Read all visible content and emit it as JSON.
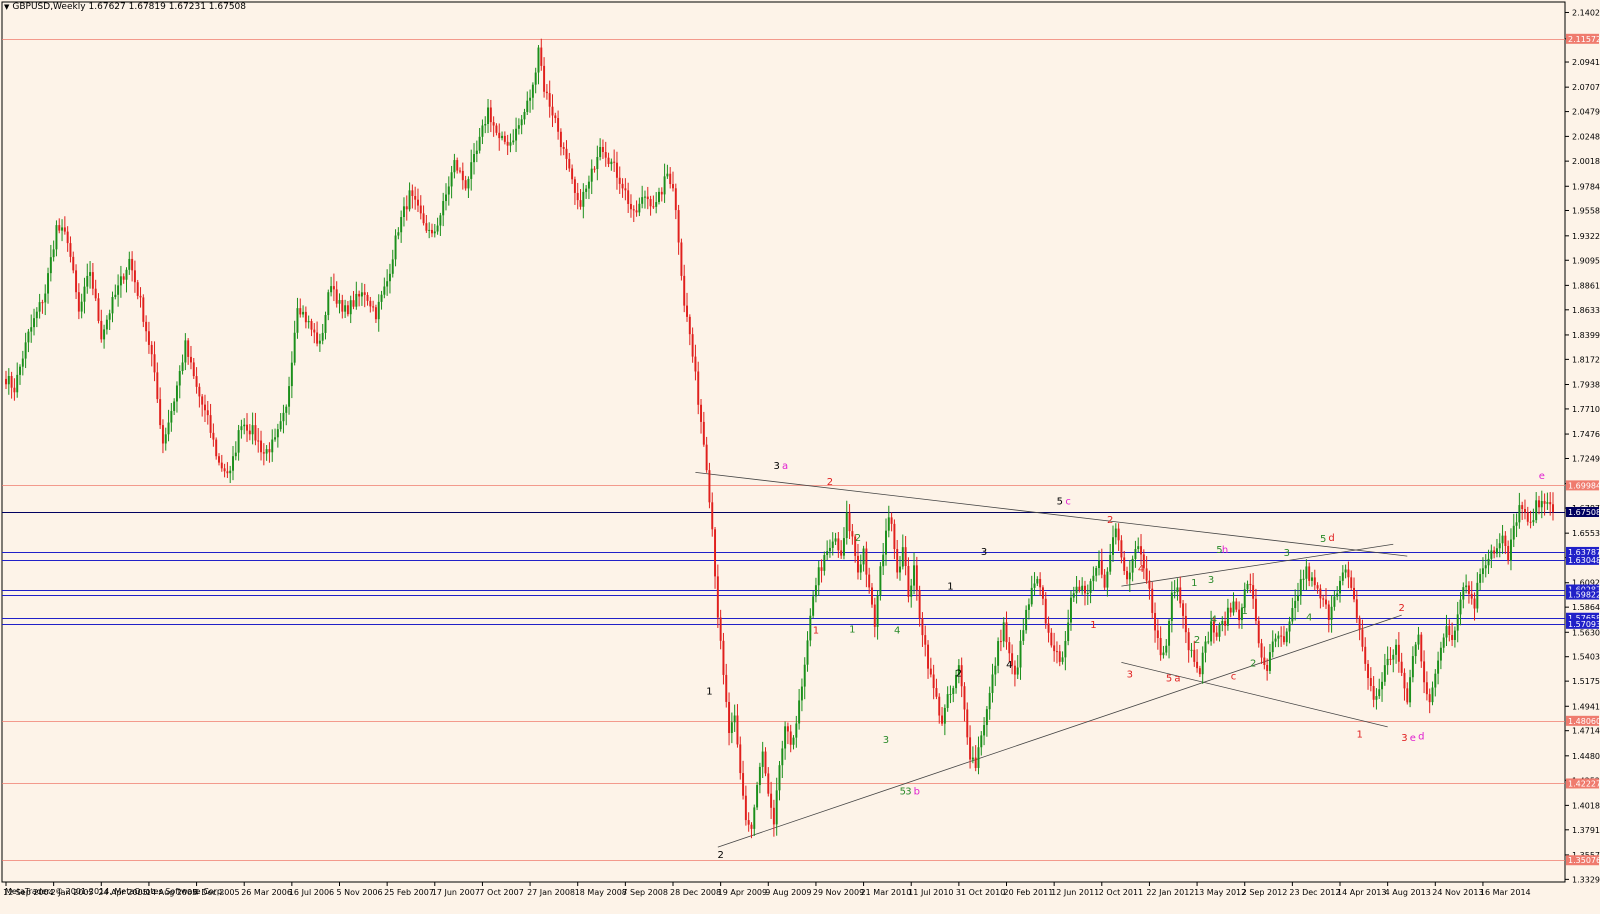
{
  "header": {
    "symbol": "GBPUSD,Weekly",
    "ohlc": "1.67627 1.67819 1.67231 1.67508"
  },
  "footer": {
    "copyright": "MetaTrader, © 2001-2014, MetaQuotes Software Corp."
  },
  "colors": {
    "background": "#fdf3e8",
    "bull": "#1b8f1b",
    "bear": "#e0201d",
    "red_level": "#ef7b6e",
    "blue_level": "#2020c8",
    "current_price": "#000060",
    "wave_magenta": "#e020d0",
    "wave_red": "#e02020",
    "wave_green": "#2a8a2a",
    "wave_black": "#000000"
  },
  "price_axis": {
    "min": 1.3305,
    "max": 2.15,
    "ticks": [
      "2.14025",
      "2.11572",
      "2.09410",
      "2.07070",
      "2.04795",
      "2.02485",
      "2.00180",
      "1.97840",
      "1.95585",
      "1.93225",
      "1.90950",
      "1.88610",
      "1.86335",
      "1.83995",
      "1.81720",
      "1.79380",
      "1.77105",
      "1.74765",
      "1.72490",
      "1.70150",
      "1.67875",
      "1.65535",
      "1.63260",
      "1.60920",
      "1.58645",
      "1.56305",
      "1.54030",
      "1.51755",
      "1.49415",
      "1.47140",
      "1.44800",
      "1.42525",
      "1.40185",
      "1.37910",
      "1.35570",
      "1.33295"
    ]
  },
  "time_axis": {
    "labels": [
      "12 Sep 2004",
      "2 Jan 2005",
      "24 Apr 2005",
      "14 Aug 2005",
      "4 Dec 2005",
      "26 Mar 2006",
      "16 Jul 2006",
      "5 Nov 2006",
      "25 Feb 2007",
      "17 Jun 2007",
      "7 Oct 2007",
      "27 Jan 2008",
      "18 May 2008",
      "7 Sep 2008",
      "28 Dec 2008",
      "19 Apr 2009",
      "9 Aug 2009",
      "29 Nov 2009",
      "21 Mar 2010",
      "11 Jul 2010",
      "31 Oct 2010",
      "20 Feb 2011",
      "12 Jun 2011",
      "2 Oct 2011",
      "22 Jan 2012",
      "13 May 2012",
      "2 Sep 2012",
      "23 Dec 2012",
      "14 Apr 2013",
      "4 Aug 2013",
      "24 Nov 2013",
      "16 Mar 2014"
    ]
  },
  "chart_data": {
    "type": "candlestick",
    "symbol": "GBPUSD",
    "timeframe": "Weekly",
    "ylim": [
      1.3305,
      2.15
    ],
    "grid": false,
    "current_price": "1.67508",
    "anchors": [
      [
        0,
        1.8
      ],
      [
        3,
        1.79
      ],
      [
        8,
        1.84
      ],
      [
        14,
        1.88
      ],
      [
        18,
        1.94
      ],
      [
        22,
        1.93
      ],
      [
        26,
        1.86
      ],
      [
        30,
        1.9
      ],
      [
        34,
        1.84
      ],
      [
        38,
        1.87
      ],
      [
        44,
        1.91
      ],
      [
        48,
        1.87
      ],
      [
        52,
        1.82
      ],
      [
        56,
        1.74
      ],
      [
        60,
        1.78
      ],
      [
        64,
        1.83
      ],
      [
        68,
        1.79
      ],
      [
        72,
        1.76
      ],
      [
        76,
        1.72
      ],
      [
        80,
        1.71
      ],
      [
        84,
        1.76
      ],
      [
        88,
        1.75
      ],
      [
        92,
        1.73
      ],
      [
        96,
        1.74
      ],
      [
        100,
        1.77
      ],
      [
        104,
        1.87
      ],
      [
        108,
        1.85
      ],
      [
        112,
        1.83
      ],
      [
        116,
        1.89
      ],
      [
        120,
        1.86
      ],
      [
        124,
        1.87
      ],
      [
        128,
        1.88
      ],
      [
        132,
        1.86
      ],
      [
        136,
        1.89
      ],
      [
        140,
        1.94
      ],
      [
        144,
        1.97
      ],
      [
        148,
        1.95
      ],
      [
        152,
        1.93
      ],
      [
        156,
        1.96
      ],
      [
        160,
        2.0
      ],
      [
        164,
        1.98
      ],
      [
        168,
        2.01
      ],
      [
        172,
        2.05
      ],
      [
        176,
        2.02
      ],
      [
        180,
        2.02
      ],
      [
        184,
        2.04
      ],
      [
        188,
        2.07
      ],
      [
        190,
        2.11
      ],
      [
        192,
        2.07
      ],
      [
        196,
        2.04
      ],
      [
        200,
        2.0
      ],
      [
        204,
        1.96
      ],
      [
        208,
        1.98
      ],
      [
        212,
        2.02
      ],
      [
        216,
        2.0
      ],
      [
        220,
        1.98
      ],
      [
        224,
        1.95
      ],
      [
        228,
        1.97
      ],
      [
        232,
        1.96
      ],
      [
        236,
        1.99
      ],
      [
        238,
        1.98
      ],
      [
        240,
        1.93
      ],
      [
        242,
        1.87
      ],
      [
        244,
        1.84
      ],
      [
        246,
        1.8
      ],
      [
        248,
        1.76
      ],
      [
        250,
        1.72
      ],
      [
        252,
        1.66
      ],
      [
        254,
        1.58
      ],
      [
        256,
        1.52
      ],
      [
        258,
        1.47
      ],
      [
        260,
        1.48
      ],
      [
        262,
        1.43
      ],
      [
        264,
        1.39
      ],
      [
        266,
        1.38
      ],
      [
        268,
        1.42
      ],
      [
        270,
        1.45
      ],
      [
        272,
        1.41
      ],
      [
        274,
        1.38
      ],
      [
        276,
        1.44
      ],
      [
        278,
        1.47
      ],
      [
        280,
        1.46
      ],
      [
        282,
        1.48
      ],
      [
        284,
        1.51
      ],
      [
        286,
        1.55
      ],
      [
        288,
        1.6
      ],
      [
        290,
        1.62
      ],
      [
        292,
        1.63
      ],
      [
        294,
        1.64
      ],
      [
        296,
        1.65
      ],
      [
        298,
        1.63
      ],
      [
        300,
        1.67
      ],
      [
        302,
        1.65
      ],
      [
        304,
        1.62
      ],
      [
        306,
        1.64
      ],
      [
        308,
        1.6
      ],
      [
        310,
        1.57
      ],
      [
        312,
        1.62
      ],
      [
        314,
        1.66
      ],
      [
        316,
        1.67
      ],
      [
        318,
        1.62
      ],
      [
        320,
        1.64
      ],
      [
        322,
        1.6
      ],
      [
        324,
        1.62
      ],
      [
        326,
        1.58
      ],
      [
        328,
        1.55
      ],
      [
        330,
        1.52
      ],
      [
        332,
        1.5
      ],
      [
        334,
        1.48
      ],
      [
        336,
        1.5
      ],
      [
        338,
        1.51
      ],
      [
        340,
        1.53
      ],
      [
        342,
        1.49
      ],
      [
        344,
        1.45
      ],
      [
        346,
        1.44
      ],
      [
        348,
        1.47
      ],
      [
        350,
        1.49
      ],
      [
        352,
        1.52
      ],
      [
        354,
        1.55
      ],
      [
        356,
        1.57
      ],
      [
        358,
        1.54
      ],
      [
        360,
        1.52
      ],
      [
        362,
        1.55
      ],
      [
        364,
        1.58
      ],
      [
        366,
        1.6
      ],
      [
        368,
        1.61
      ],
      [
        370,
        1.59
      ],
      [
        372,
        1.56
      ],
      [
        374,
        1.55
      ],
      [
        376,
        1.53
      ],
      [
        378,
        1.56
      ],
      [
        380,
        1.59
      ],
      [
        382,
        1.6
      ],
      [
        384,
        1.61
      ],
      [
        386,
        1.6
      ],
      [
        388,
        1.62
      ],
      [
        390,
        1.63
      ],
      [
        392,
        1.61
      ],
      [
        394,
        1.64
      ],
      [
        396,
        1.66
      ],
      [
        398,
        1.63
      ],
      [
        400,
        1.61
      ],
      [
        402,
        1.63
      ],
      [
        404,
        1.64
      ],
      [
        406,
        1.62
      ],
      [
        408,
        1.6
      ],
      [
        410,
        1.57
      ],
      [
        412,
        1.54
      ],
      [
        414,
        1.55
      ],
      [
        416,
        1.6
      ],
      [
        418,
        1.61
      ],
      [
        420,
        1.58
      ],
      [
        422,
        1.55
      ],
      [
        424,
        1.54
      ],
      [
        426,
        1.53
      ],
      [
        428,
        1.55
      ],
      [
        430,
        1.57
      ],
      [
        432,
        1.56
      ],
      [
        434,
        1.57
      ],
      [
        436,
        1.58
      ],
      [
        438,
        1.59
      ],
      [
        440,
        1.58
      ],
      [
        442,
        1.6
      ],
      [
        444,
        1.61
      ],
      [
        446,
        1.57
      ],
      [
        448,
        1.54
      ],
      [
        450,
        1.53
      ],
      [
        452,
        1.55
      ],
      [
        454,
        1.56
      ],
      [
        456,
        1.55
      ],
      [
        458,
        1.57
      ],
      [
        460,
        1.59
      ],
      [
        462,
        1.61
      ],
      [
        464,
        1.62
      ],
      [
        466,
        1.61
      ],
      [
        468,
        1.6
      ],
      [
        470,
        1.59
      ],
      [
        472,
        1.58
      ],
      [
        474,
        1.6
      ],
      [
        476,
        1.61
      ],
      [
        478,
        1.62
      ],
      [
        480,
        1.6
      ],
      [
        482,
        1.58
      ],
      [
        484,
        1.55
      ],
      [
        486,
        1.52
      ],
      [
        488,
        1.5
      ],
      [
        490,
        1.51
      ],
      [
        492,
        1.53
      ],
      [
        494,
        1.54
      ],
      [
        496,
        1.55
      ],
      [
        498,
        1.52
      ],
      [
        500,
        1.5
      ],
      [
        502,
        1.54
      ],
      [
        504,
        1.56
      ],
      [
        506,
        1.52
      ],
      [
        508,
        1.5
      ],
      [
        510,
        1.52
      ],
      [
        512,
        1.55
      ],
      [
        514,
        1.57
      ],
      [
        516,
        1.56
      ],
      [
        518,
        1.58
      ],
      [
        520,
        1.61
      ],
      [
        522,
        1.6
      ],
      [
        524,
        1.59
      ],
      [
        526,
        1.62
      ],
      [
        528,
        1.63
      ],
      [
        530,
        1.64
      ],
      [
        532,
        1.64
      ],
      [
        534,
        1.65
      ],
      [
        536,
        1.63
      ],
      [
        538,
        1.66
      ],
      [
        540,
        1.68
      ],
      [
        542,
        1.67
      ],
      [
        544,
        1.66
      ],
      [
        546,
        1.68
      ],
      [
        548,
        1.69
      ],
      [
        550,
        1.68
      ],
      [
        552,
        1.675
      ]
    ],
    "total_bars": 553,
    "horizontal_levels": [
      {
        "price": "2.11572",
        "kind": "red"
      },
      {
        "price": "1.69984",
        "kind": "red"
      },
      {
        "price": "1.48060",
        "kind": "red"
      },
      {
        "price": "1.42227",
        "kind": "red"
      },
      {
        "price": "1.35076",
        "kind": "red"
      },
      {
        "price": "1.63787",
        "kind": "blue"
      },
      {
        "price": "1.63048",
        "kind": "blue"
      },
      {
        "price": "1.60287",
        "kind": "blue"
      },
      {
        "price": "1.59822",
        "kind": "blue"
      },
      {
        "price": "1.57658",
        "kind": "blue"
      },
      {
        "price": "1.57093",
        "kind": "blue"
      },
      {
        "price": "1.67508",
        "kind": "current"
      }
    ],
    "trendlines": [
      {
        "from": [
          246,
          1.712
        ],
        "to": [
          500,
          1.634
        ]
      },
      {
        "from": [
          254,
          1.363
        ],
        "to": [
          498,
          1.579
        ]
      },
      {
        "from": [
          398,
          1.606
        ],
        "to": [
          495,
          1.645
        ]
      },
      {
        "from": [
          398,
          1.535
        ],
        "to": [
          493,
          1.475
        ]
      }
    ],
    "wave_labels": [
      {
        "text": "3",
        "bar": 275,
        "price": 1.715,
        "color": "wave_black"
      },
      {
        "text": "a",
        "bar": 278,
        "price": 1.715,
        "color": "wave_magenta"
      },
      {
        "text": "2",
        "bar": 294,
        "price": 1.7,
        "color": "wave_red"
      },
      {
        "text": "5",
        "bar": 376,
        "price": 1.682,
        "color": "wave_black"
      },
      {
        "text": "c",
        "bar": 379,
        "price": 1.682,
        "color": "wave_magenta"
      },
      {
        "text": "2",
        "bar": 394,
        "price": 1.665,
        "color": "wave_red"
      },
      {
        "text": "5",
        "bar": 470,
        "price": 1.647,
        "color": "wave_green"
      },
      {
        "text": "d",
        "bar": 473,
        "price": 1.648,
        "color": "wave_red"
      },
      {
        "text": "e",
        "bar": 548,
        "price": 1.706,
        "color": "wave_magenta"
      },
      {
        "text": "2",
        "bar": 304,
        "price": 1.648,
        "color": "wave_green"
      },
      {
        "text": "3",
        "bar": 349,
        "price": 1.635,
        "color": "wave_black"
      },
      {
        "text": "5",
        "bar": 433,
        "price": 1.637,
        "color": "wave_green"
      },
      {
        "text": "h",
        "bar": 435,
        "price": 1.637,
        "color": "wave_magenta"
      },
      {
        "text": "3",
        "bar": 457,
        "price": 1.634,
        "color": "wave_green"
      },
      {
        "text": "4",
        "bar": 405,
        "price": 1.619,
        "color": "wave_red"
      },
      {
        "text": "1",
        "bar": 337,
        "price": 1.603,
        "color": "wave_black"
      },
      {
        "text": "1",
        "bar": 424,
        "price": 1.606,
        "color": "wave_green"
      },
      {
        "text": "3",
        "bar": 430,
        "price": 1.609,
        "color": "wave_green"
      },
      {
        "text": "1",
        "bar": 302,
        "price": 1.563,
        "color": "wave_green"
      },
      {
        "text": "1",
        "bar": 289,
        "price": 1.562,
        "color": "wave_red"
      },
      {
        "text": "4",
        "bar": 318,
        "price": 1.562,
        "color": "wave_green"
      },
      {
        "text": "1",
        "bar": 388,
        "price": 1.567,
        "color": "wave_red"
      },
      {
        "text": "1",
        "bar": 442,
        "price": 1.58,
        "color": "wave_green"
      },
      {
        "text": "4",
        "bar": 431,
        "price": 1.572,
        "color": "wave_green"
      },
      {
        "text": "4",
        "bar": 465,
        "price": 1.574,
        "color": "wave_green"
      },
      {
        "text": "2",
        "bar": 425,
        "price": 1.553,
        "color": "wave_green"
      },
      {
        "text": "2",
        "bar": 445,
        "price": 1.531,
        "color": "wave_green"
      },
      {
        "text": "2",
        "bar": 340,
        "price": 1.522,
        "color": "wave_black"
      },
      {
        "text": "4",
        "bar": 358,
        "price": 1.53,
        "color": "wave_black"
      },
      {
        "text": "3",
        "bar": 401,
        "price": 1.521,
        "color": "wave_red"
      },
      {
        "text": "5",
        "bar": 415,
        "price": 1.517,
        "color": "wave_red"
      },
      {
        "text": "a",
        "bar": 418,
        "price": 1.517,
        "color": "wave_red"
      },
      {
        "text": "c",
        "bar": 438,
        "price": 1.519,
        "color": "wave_red"
      },
      {
        "text": "2",
        "bar": 498,
        "price": 1.583,
        "color": "wave_red"
      },
      {
        "text": "1",
        "bar": 251,
        "price": 1.505,
        "color": "wave_black"
      },
      {
        "text": "3",
        "bar": 314,
        "price": 1.46,
        "color": "wave_green"
      },
      {
        "text": "1",
        "bar": 483,
        "price": 1.465,
        "color": "wave_red"
      },
      {
        "text": "3",
        "bar": 499,
        "price": 1.462,
        "color": "wave_red"
      },
      {
        "text": "e",
        "bar": 502,
        "price": 1.462,
        "color": "wave_magenta"
      },
      {
        "text": "d",
        "bar": 505,
        "price": 1.463,
        "color": "wave_magenta"
      },
      {
        "text": "5",
        "bar": 320,
        "price": 1.412,
        "color": "wave_green"
      },
      {
        "text": "3",
        "bar": 322,
        "price": 1.412,
        "color": "wave_green"
      },
      {
        "text": "b",
        "bar": 325,
        "price": 1.412,
        "color": "wave_magenta"
      },
      {
        "text": "2",
        "bar": 255,
        "price": 1.353,
        "color": "wave_black"
      }
    ]
  }
}
